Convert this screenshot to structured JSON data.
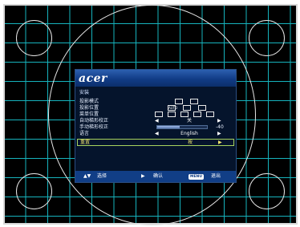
{
  "brand": {
    "logo": "acer"
  },
  "osd": {
    "section_title": "安装",
    "rows": [
      {
        "label": "投影模式"
      },
      {
        "label": "投影位置",
        "icon_text": "AUTO"
      },
      {
        "label": "菜单位置"
      },
      {
        "label": "自动梯形校正",
        "value": "关"
      },
      {
        "label": "手动梯形校正",
        "slider_value": -40,
        "slider_fraction": 0.45,
        "value_text": "-40"
      },
      {
        "label": "语言",
        "value": "English"
      },
      {
        "label": "重置",
        "value": "按"
      }
    ],
    "footer": {
      "select_arrows": "▲▼",
      "select_label": "选择",
      "confirm_arrow": "▶",
      "confirm_label": "确认",
      "menu_key": "MENU",
      "exit_label": "退出"
    }
  },
  "colors": {
    "grid": "#16b3bd",
    "osd_bg": "#05142c",
    "header_blue": "#113c86",
    "highlight_border": "#a8d35e",
    "highlight_text": "#f1e56f"
  }
}
